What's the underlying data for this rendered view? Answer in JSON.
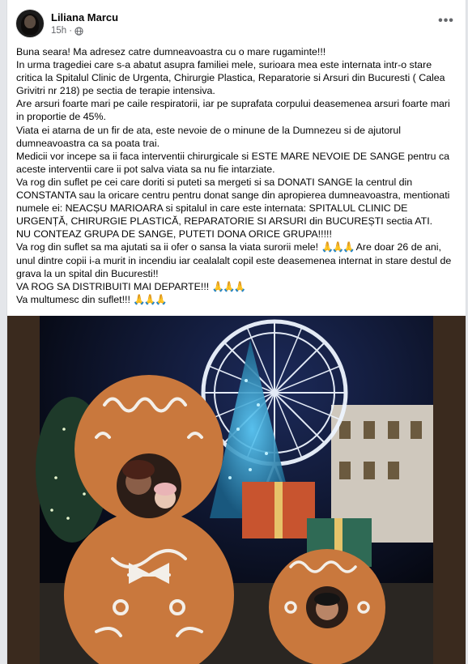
{
  "post": {
    "author": "Liliana Marcu",
    "time": "15h",
    "separator": "·",
    "privacy_icon": "globe-icon",
    "more_icon": "more-options-icon",
    "more_label": "•••",
    "paragraphs": [
      "Buna seara! Ma adresez catre dumneavoastra cu o mare rugaminte!!!",
      "In urma tragediei care s-a abatut asupra familiei mele, surioara mea este internata intr-o stare critica la Spitalul Clinic de Urgenta, Chirurgie Plastica, Reparatorie si Arsuri din Bucuresti ( Calea Grivitri nr 218) pe sectia de terapie intensiva.",
      "Are arsuri foarte mari pe caile respiratorii, iar pe suprafata corpului deasemenea arsuri foarte mari in proportie de 45%.",
      "Viata ei atarna de un fir de ata, este nevoie de o minune de la Dumnezeu si de ajutorul dumneavoastra ca sa poata trai.",
      "Medicii vor incepe sa ii faca interventii chirurgicale si ESTE MARE NEVOIE DE SANGE pentru ca aceste interventii care ii pot salva viata sa nu fie intarziate.",
      "Va rog din suflet pe cei care doriti si puteti sa mergeti si sa DONATI SANGE la centrul din CONSTANTA sau la oricare centru pentru donat sange din apropierea dumneavoastra, mentionati numele ei: NEACȘU MARIOARA si spitalul in care este internata: SPITALUL CLINIC DE URGENȚĂ, CHIRURGIE PLASTICĂ, REPARATORIE SI ARSURI din BUCUREȘTI sectia ATI.",
      "NU CONTEAZ GRUPA DE SANGE, PUTETI DONA ORICE GRUPA!!!!!"
    ],
    "p8_start": "Va rog din suflet sa ma ajutati sa ii ofer o sansa la viata surorii mele!",
    "p8_emoji": "🙏🙏🙏",
    "p8_end": "Are doar 26 de ani, unul dintre copii i-a murit in incendiu iar cealalalt copil este deasemenea internat in stare destul de grava la un spital din Bucuresti!!",
    "p9_text": "VA ROG SA DISTRIBUITI MAI DEPARTE!!!",
    "p9_emoji": "🙏🙏🙏",
    "p10_text": "Va multumesc din suflet!!!",
    "p10_emoji": "🙏🙏🙏"
  },
  "photo": {
    "content": "family-photo-gingerbread-cutout",
    "colors": {
      "sky": "#0b1026",
      "gingerbread": "#c9783d",
      "icing": "#f3efe9",
      "wheel_lights": "#eef5ff",
      "tree": "#2f8fb8"
    }
  }
}
